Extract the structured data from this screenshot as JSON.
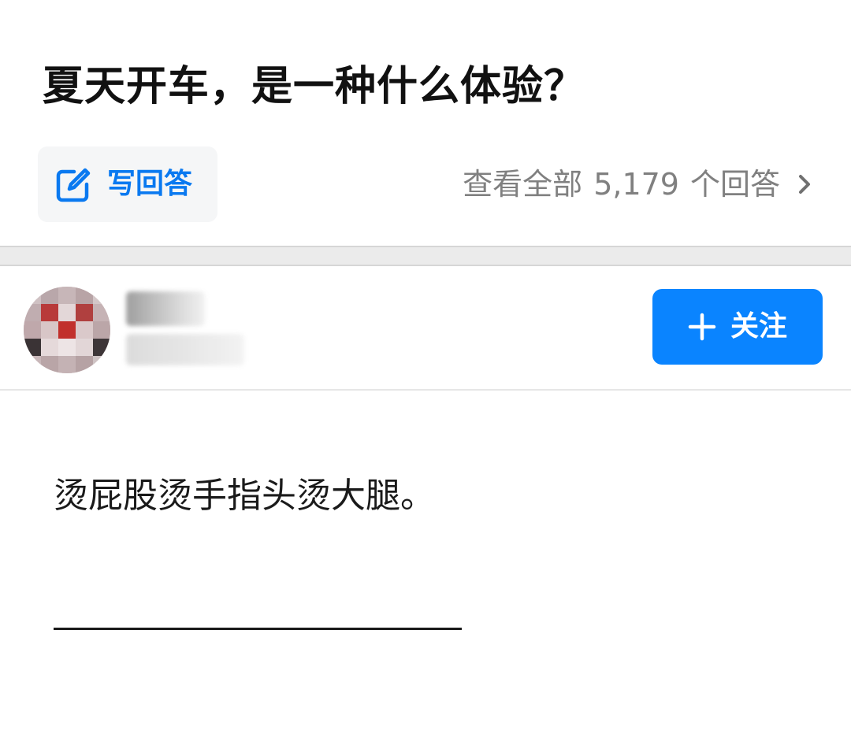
{
  "question": {
    "title": "夏天开车，是一种什么体验？",
    "write_answer_label": "写回答",
    "view_all_prefix": "查看全部",
    "answer_count": "5,179",
    "view_all_suffix": "个回答",
    "icons": {
      "write": "edit-icon",
      "view_all": "chevron-right-icon"
    }
  },
  "author": {
    "avatar_icon": "avatar",
    "follow_label": "关注",
    "follow_icon": "plus-icon"
  },
  "answer": {
    "text": "烫屁股烫手指头烫大腿。"
  },
  "colors": {
    "accent_blue": "#0a84ff",
    "link_blue": "#0a79f0",
    "muted_gray": "#808080",
    "divider_gray": "#ebebeb"
  }
}
